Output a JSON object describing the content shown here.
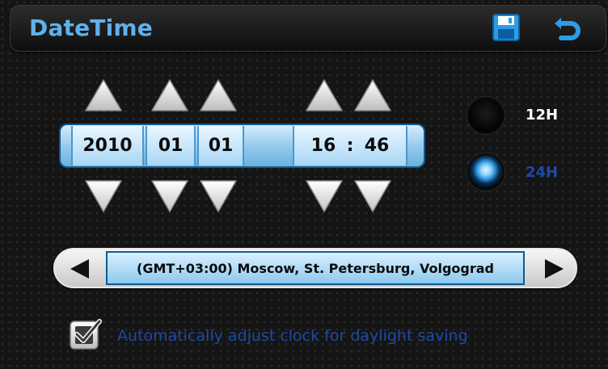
{
  "header": {
    "title": "DateTime",
    "save_icon": "floppy-disk-icon",
    "back_icon": "return-arrow-icon"
  },
  "datetime": {
    "year": "2010",
    "month": "01",
    "day": "01",
    "hour": "16",
    "separator": ":",
    "minute": "46"
  },
  "clock_format": {
    "option_12h": "12H",
    "option_24h": "24H",
    "selected": "24H"
  },
  "timezone": {
    "value": "(GMT+03:00) Moscow, St. Petersburg, Volgograd"
  },
  "dst": {
    "label": "Automatically adjust clock for daylight saving",
    "checked": true
  },
  "colors": {
    "accent": "#5fb1ea",
    "field": "#a8d6f5",
    "label_blue": "#1d4aa8"
  }
}
